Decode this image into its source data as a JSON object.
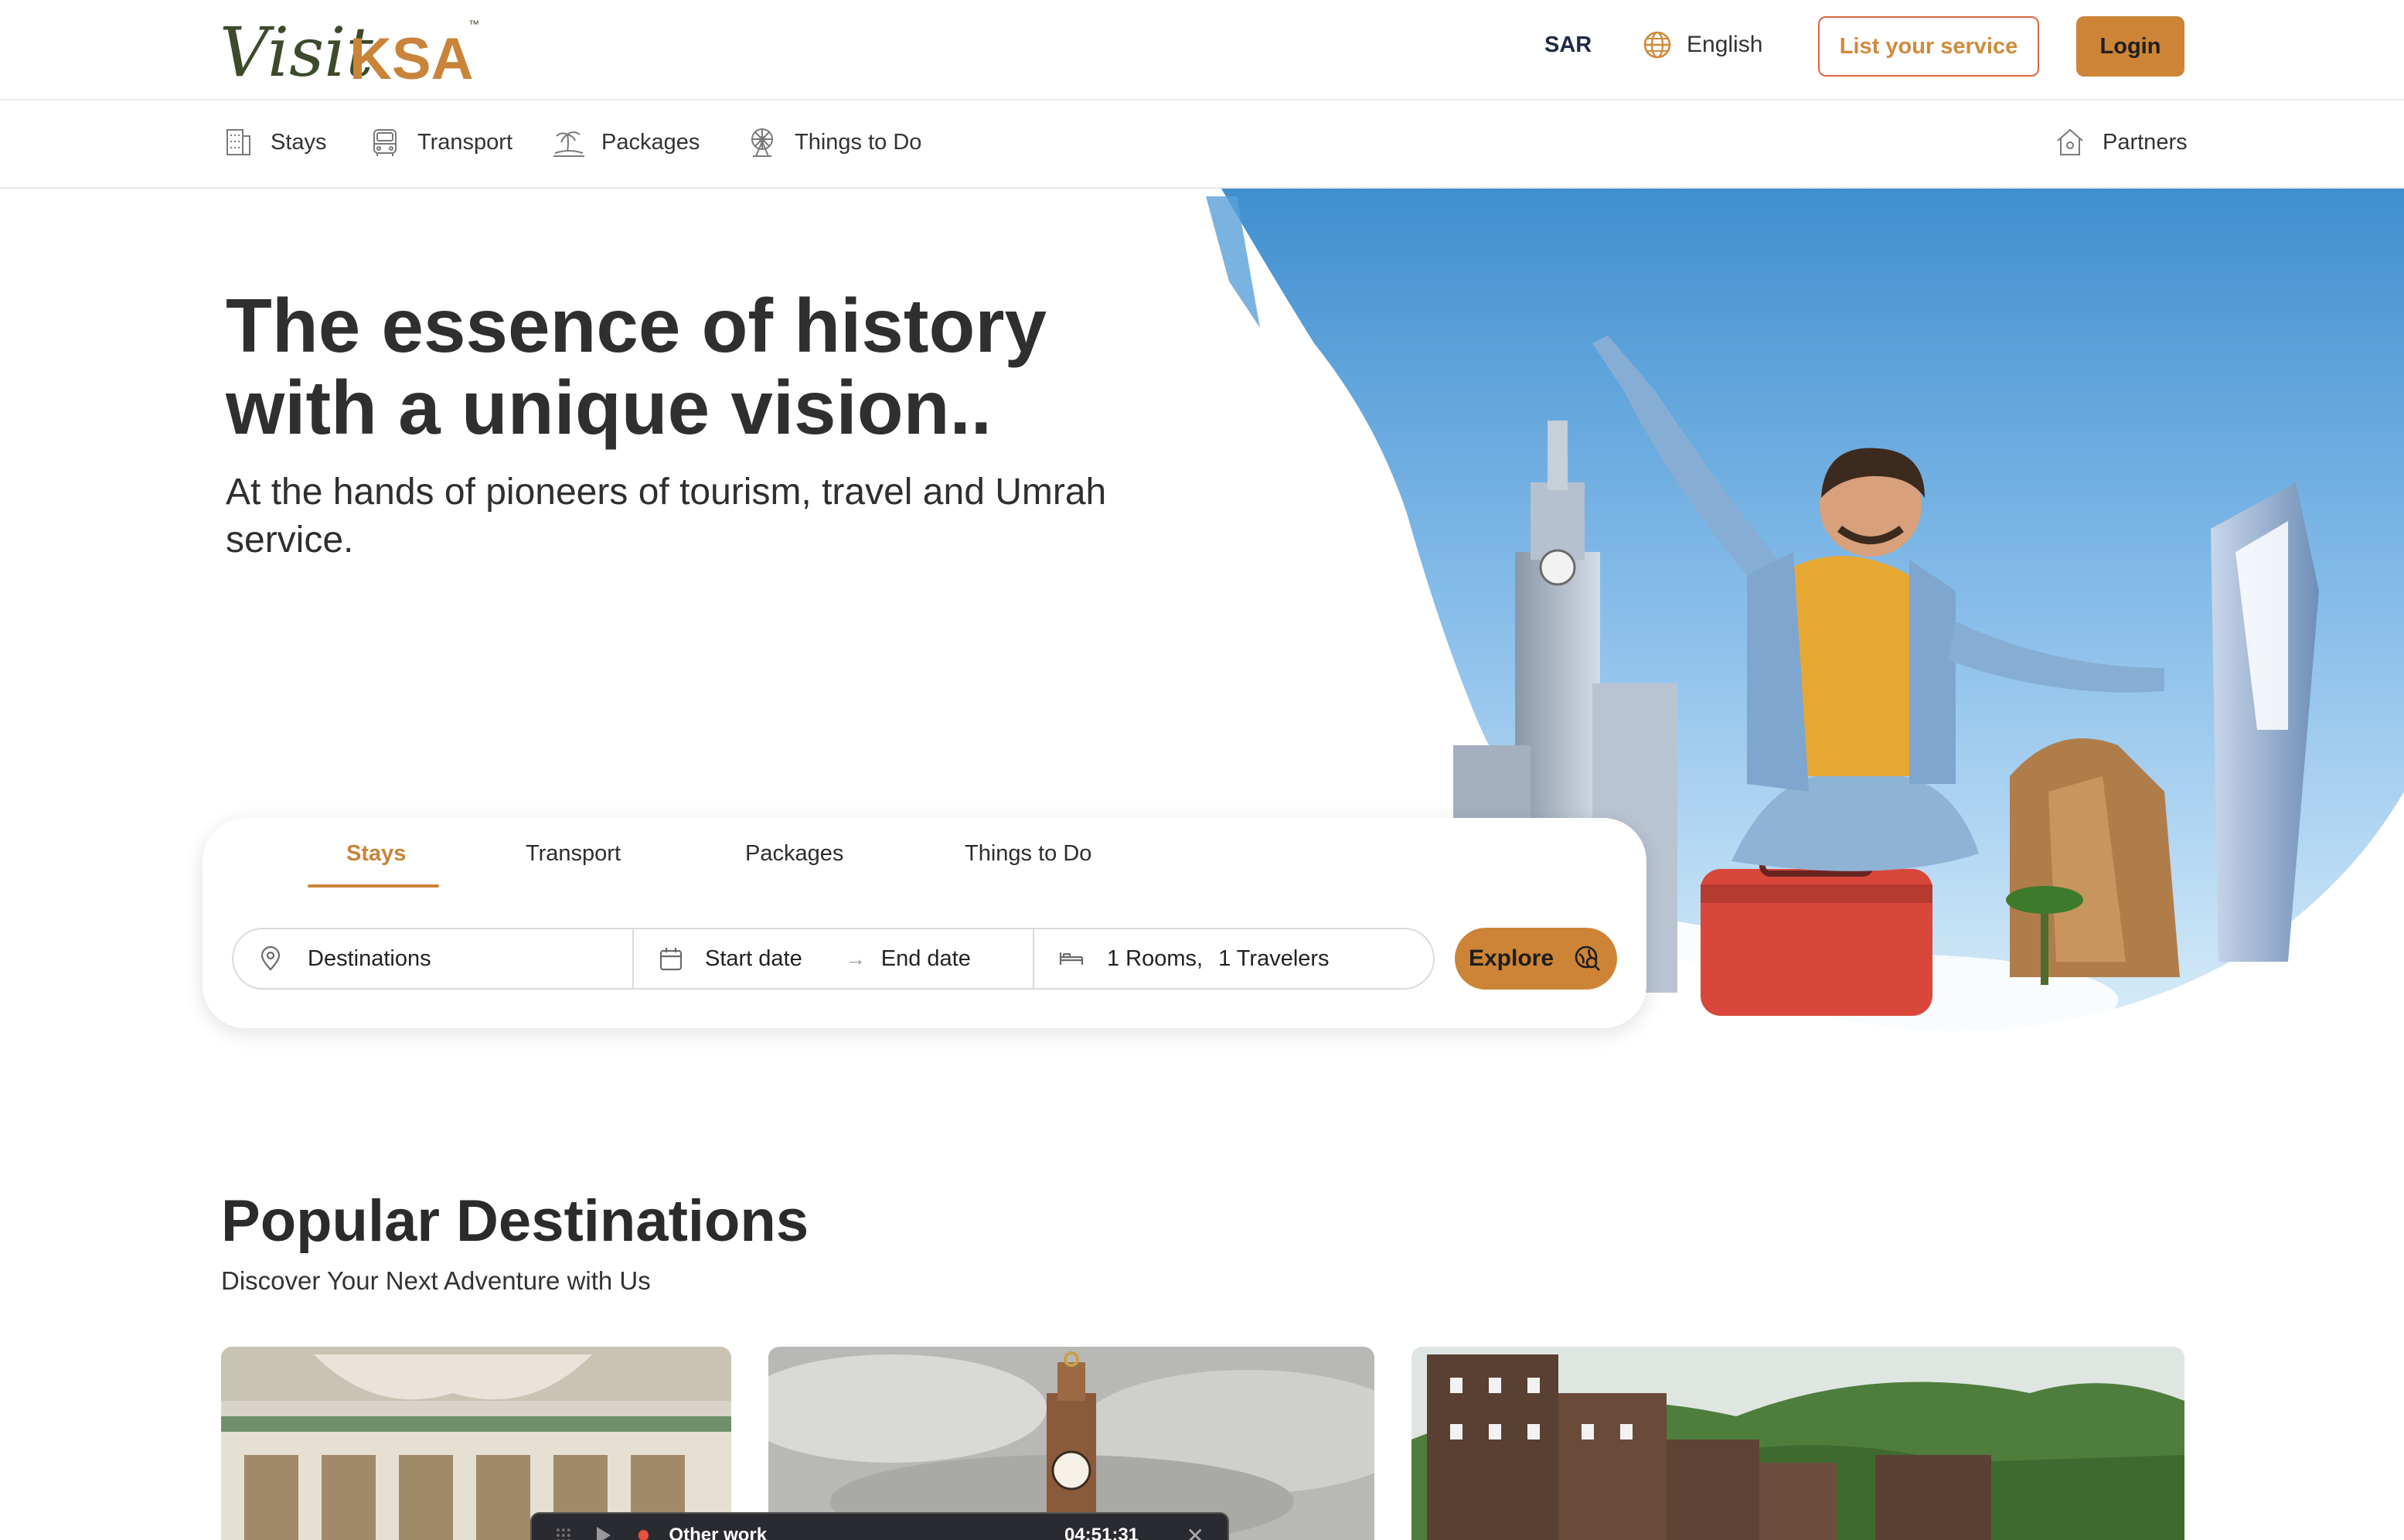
{
  "header": {
    "logo_text_script": "Visit",
    "logo_text_bold": "KSA",
    "logo_tm": "™",
    "currency": "SAR",
    "language": "English",
    "list_service_label": "List your service",
    "login_label": "Login"
  },
  "nav": {
    "items": [
      {
        "label": "Stays",
        "icon": "building-icon"
      },
      {
        "label": "Transport",
        "icon": "bus-icon"
      },
      {
        "label": "Packages",
        "icon": "palm-island-icon"
      },
      {
        "label": "Things to Do",
        "icon": "ferris-wheel-icon"
      }
    ],
    "partners_label": "Partners"
  },
  "hero": {
    "title_line1": "The essence of history",
    "title_line2": "with a unique vision..",
    "subtitle_line1": "At the hands of pioneers of tourism, travel and Umrah",
    "subtitle_line2": "service."
  },
  "search": {
    "tabs": [
      "Stays",
      "Transport",
      "Packages",
      "Things to Do"
    ],
    "active_tab": "Stays",
    "destination_placeholder": "Destinations",
    "start_date_placeholder": "Start date",
    "end_date_placeholder": "End date",
    "rooms": "1 Rooms,",
    "travelers": "1 Travelers",
    "explore_label": "Explore"
  },
  "popular": {
    "title": "Popular Destinations",
    "subtitle": "Discover Your Next Adventure with Us"
  },
  "recorder": {
    "label": "Other work",
    "time": "04:51:31"
  },
  "colors": {
    "accent": "#cd8436",
    "accent_text": "#c9843a",
    "outline_button_border": "#d9663f",
    "sky": "#4a97d4"
  }
}
